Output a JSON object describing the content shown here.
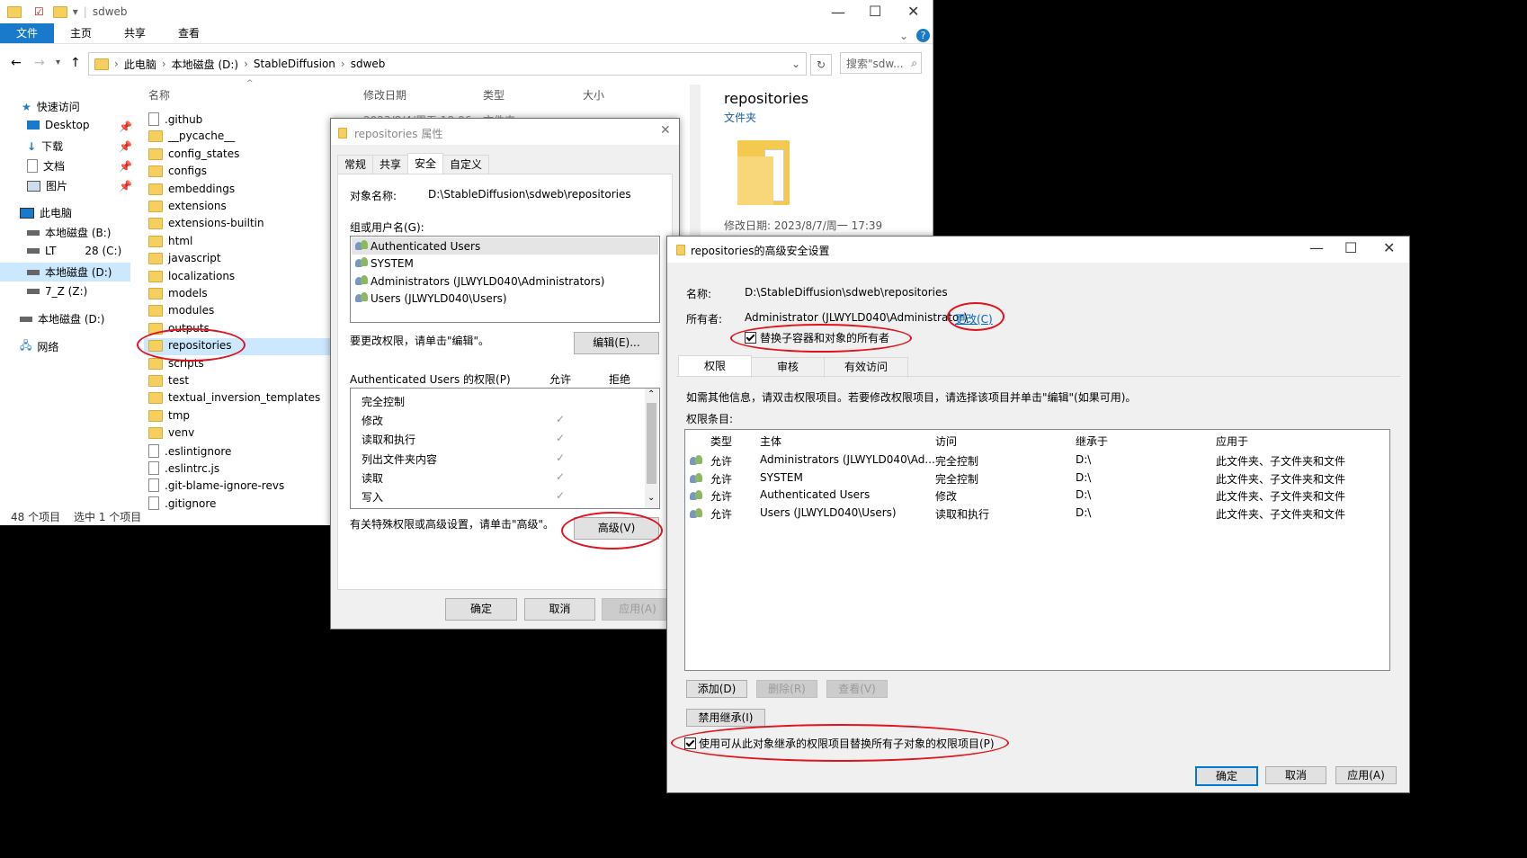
{
  "explorer": {
    "title": "sdweb",
    "ribbon_tabs": [
      "文件",
      "主页",
      "共享",
      "查看"
    ],
    "breadcrumb": [
      "此电脑",
      "本地磁盘 (D:)",
      "StableDiffusion",
      "sdweb"
    ],
    "search_placeholder": "搜索\"sdw...",
    "columns": {
      "name": "名称",
      "modified": "修改日期",
      "type": "类型",
      "size": "大小"
    },
    "nav": {
      "quick_access": "快速访问",
      "desktop": "Desktop",
      "downloads": "下载",
      "documents": "文档",
      "pictures": "图片",
      "this_pc": "此电脑",
      "drive_b": "本地磁盘 (B:)",
      "drive_c_prefix": "LT",
      "drive_c_suffix": "28 (C:)",
      "drive_d": "本地磁盘 (D:)",
      "drive_z": "7_Z (Z:)",
      "drive_d2": "本地磁盘 (D:)",
      "network": "网络"
    },
    "files": [
      ".github",
      "__pycache__",
      "config_states",
      "configs",
      "embeddings",
      "extensions",
      "extensions-builtin",
      "html",
      "javascript",
      "localizations",
      "models",
      "modules",
      "outputs",
      "repositories",
      "scripts",
      "test",
      "textual_inversion_templates",
      "tmp",
      "venv",
      ".eslintignore",
      ".eslintrc.js",
      ".git-blame-ignore-revs",
      ".gitignore"
    ],
    "first_row_date": "2023/8/4/周五 18:06",
    "first_row_type": "文件夹",
    "status_count": "48 个项目",
    "status_selected": "选中 1 个项目",
    "preview": {
      "name": "repositories",
      "type": "文件夹",
      "modified": "修改日期:   2023/8/7/周一 17:39"
    }
  },
  "props": {
    "title": "repositories 属性",
    "tabs": [
      "常规",
      "共享",
      "安全",
      "自定义"
    ],
    "object_label": "对象名称:",
    "object_value": "D:\\StableDiffusion\\sdweb\\repositories",
    "group_label": "组或用户名(G):",
    "users": [
      "Authenticated Users",
      "SYSTEM",
      "Administrators (JLWYLD040\\Administrators)",
      "Users (JLWYLD040\\Users)"
    ],
    "edit_hint": "要更改权限，请单击\"编辑\"。",
    "edit_button": "编辑(E)...",
    "perm_header": "Authenticated Users 的权限(P)",
    "allow": "允许",
    "deny": "拒绝",
    "permissions": [
      "完全控制",
      "修改",
      "读取和执行",
      "列出文件夹内容",
      "读取",
      "写入"
    ],
    "advanced_hint": "有关特殊权限或高级设置，请单击\"高级\"。",
    "advanced_button": "高级(V)",
    "ok": "确定",
    "cancel": "取消",
    "apply": "应用(A)"
  },
  "adv": {
    "title": "repositories的高级安全设置",
    "name_label": "名称:",
    "name_value": "D:\\StableDiffusion\\sdweb\\repositories",
    "owner_label": "所有者:",
    "owner_value": "Administrator (JLWYLD040\\Administrator)",
    "change_link": "更改(C)",
    "replace_owner": "替换子容器和对象的所有者",
    "tabs": [
      "权限",
      "审核",
      "有效访问"
    ],
    "info": "如需其他信息，请双击权限项目。若要修改权限项目，请选择该项目并单击\"编辑\"(如果可用)。",
    "entries_label": "权限条目:",
    "headers": {
      "type": "类型",
      "principal": "主体",
      "access": "访问",
      "inherited": "继承于",
      "applies": "应用于"
    },
    "rows": [
      {
        "type": "允许",
        "principal": "Administrators (JLWYLD040\\Ad...",
        "access": "完全控制",
        "inherited": "D:\\",
        "applies": "此文件夹、子文件夹和文件"
      },
      {
        "type": "允许",
        "principal": "SYSTEM",
        "access": "完全控制",
        "inherited": "D:\\",
        "applies": "此文件夹、子文件夹和文件"
      },
      {
        "type": "允许",
        "principal": "Authenticated Users",
        "access": "修改",
        "inherited": "D:\\",
        "applies": "此文件夹、子文件夹和文件"
      },
      {
        "type": "允许",
        "principal": "Users (JLWYLD040\\Users)",
        "access": "读取和执行",
        "inherited": "D:\\",
        "applies": "此文件夹、子文件夹和文件"
      }
    ],
    "add": "添加(D)",
    "remove": "删除(R)",
    "view": "查看(V)",
    "disable_inherit": "禁用继承(I)",
    "replace_child": "使用可从此对象继承的权限项目替换所有子对象的权限项目(P)",
    "ok": "确定",
    "cancel": "取消",
    "apply": "应用(A)"
  }
}
